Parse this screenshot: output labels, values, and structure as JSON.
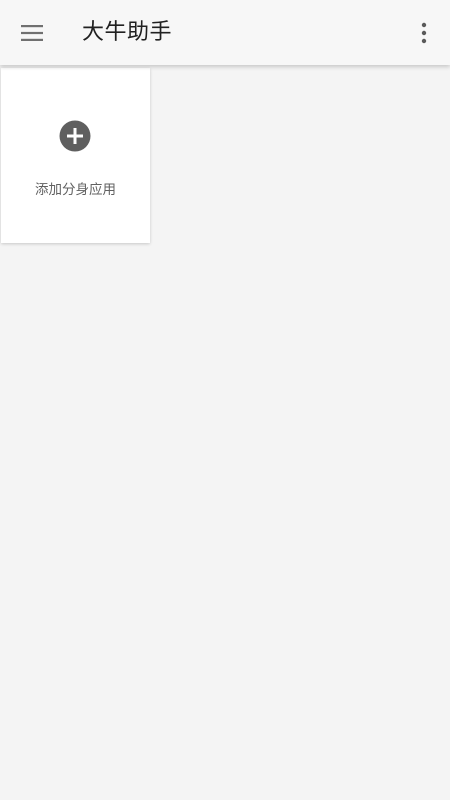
{
  "toolbar": {
    "title": "大牛助手",
    "menu_icon": "menu-icon",
    "more_icon": "more-vert-icon"
  },
  "main": {
    "add_card": {
      "label": "添加分身应用",
      "icon": "add-circle-icon"
    }
  },
  "colors": {
    "toolbar_bg": "#f7f7f7",
    "page_bg": "#f4f4f4",
    "icon_dark": "#5f5f5f",
    "title_text": "#212121"
  }
}
